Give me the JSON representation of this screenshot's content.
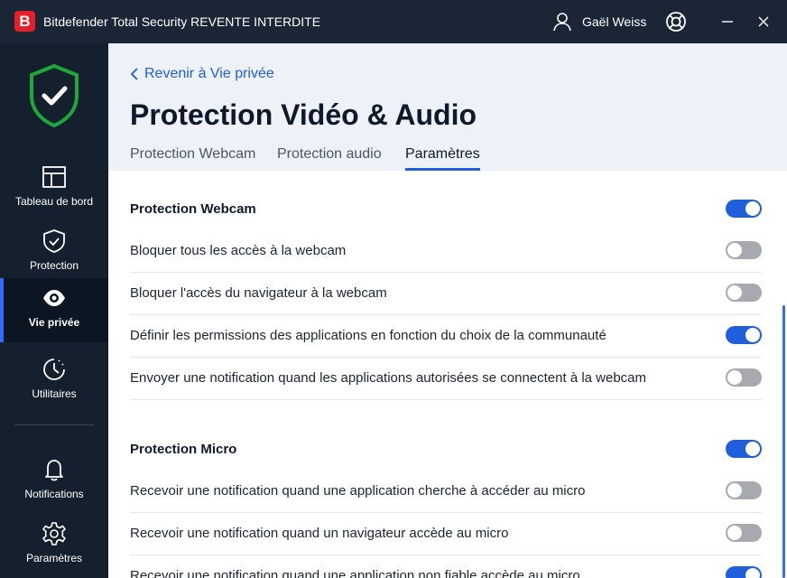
{
  "window": {
    "app_title": "Bitdefender Total Security REVENTE INTERDITE",
    "logo_letter": "B",
    "user_name": "Gaël Weiss",
    "colors": {
      "titlebar": "#1a2536",
      "sidebar": "#15202f",
      "accent": "#1f5edc",
      "logo": "#e4202b",
      "shield": "#1ea83a"
    }
  },
  "sidebar": {
    "items": [
      {
        "label": "Tableau de bord",
        "icon": "dashboard-icon"
      },
      {
        "label": "Protection",
        "icon": "shield-check-icon"
      },
      {
        "label": "Vie privée",
        "icon": "eye-icon",
        "active": true
      },
      {
        "label": "Utilitaires",
        "icon": "clock-gauge-icon"
      },
      {
        "label": "Notifications",
        "icon": "bell-icon"
      },
      {
        "label": "Paramètres",
        "icon": "gear-icon"
      }
    ]
  },
  "header": {
    "back_label": "Revenir à Vie privée",
    "title": "Protection Vidéo & Audio",
    "tabs": [
      {
        "label": "Protection Webcam"
      },
      {
        "label": "Protection audio"
      },
      {
        "label": "Paramètres",
        "active": true
      }
    ]
  },
  "content": {
    "webcam_section": {
      "title": "Protection Webcam",
      "enabled": true,
      "rows": [
        {
          "label": "Bloquer tous les accès à la webcam",
          "enabled": false
        },
        {
          "label": "Bloquer l'accès du navigateur à la webcam",
          "enabled": false
        },
        {
          "label": "Définir les permissions des applications en fonction du choix de la communauté",
          "enabled": true
        },
        {
          "label": "Envoyer une notification quand les applications autorisées se connectent à la webcam",
          "enabled": false
        }
      ]
    },
    "micro_section": {
      "title": "Protection Micro",
      "enabled": true,
      "rows": [
        {
          "label": "Recevoir une notification quand une application cherche à accéder au micro",
          "enabled": false
        },
        {
          "label": "Recevoir une notification quand un navigateur accède au micro",
          "enabled": false
        },
        {
          "label": "Recevoir une notification quand une application non fiable accède au micro",
          "enabled": true
        }
      ]
    }
  }
}
